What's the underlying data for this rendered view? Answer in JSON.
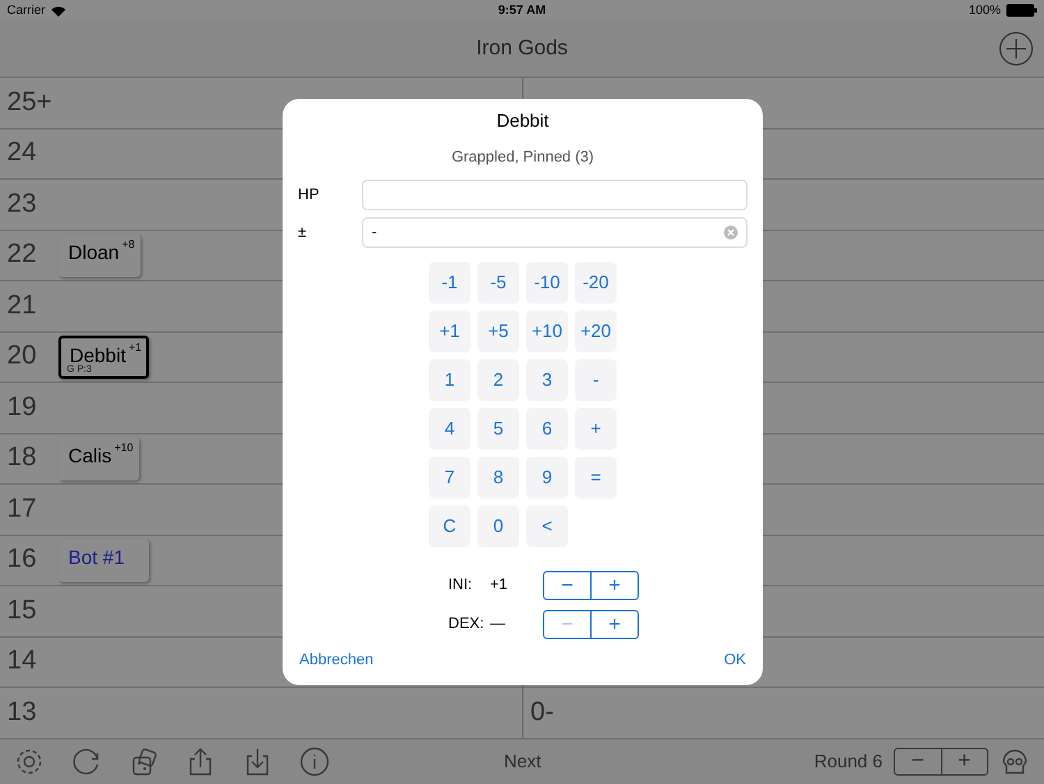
{
  "status_bar": {
    "carrier": "Carrier",
    "time": "9:57 AM",
    "battery": "100%"
  },
  "nav": {
    "title": "Iron Gods"
  },
  "left_rows": [
    {
      "label": "25+"
    },
    {
      "label": "24"
    },
    {
      "label": "23"
    },
    {
      "label": "22",
      "token": {
        "name": "Dloan",
        "modifier": "+8",
        "selected": false,
        "color": "#000000"
      }
    },
    {
      "label": "21"
    },
    {
      "label": "20",
      "token": {
        "name": "Debbit",
        "modifier": "+1",
        "note": "G P:3",
        "selected": true,
        "color": "#000000"
      }
    },
    {
      "label": "19"
    },
    {
      "label": "18",
      "token": {
        "name": "Calis",
        "modifier": "+10",
        "selected": false,
        "color": "#000000"
      }
    },
    {
      "label": "17"
    },
    {
      "label": "16",
      "token": {
        "name": "Bot #1",
        "selected": false,
        "color": "#1e1e8c"
      }
    },
    {
      "label": "15"
    },
    {
      "label": "14"
    },
    {
      "label": "13"
    }
  ],
  "right_rows": [
    {
      "label": "0-"
    }
  ],
  "dialog": {
    "title": "Debbit",
    "subtitle": "Grappled, Pinned (3)",
    "fields": [
      {
        "label": "HP",
        "clearable": false
      },
      {
        "label": "±",
        "value": "-",
        "clearable": true
      }
    ],
    "keypad": [
      [
        "-1",
        "-5",
        "-10",
        "-20"
      ],
      [
        "+1",
        "+5",
        "+10",
        "+20"
      ],
      [
        "1",
        "2",
        "3",
        "-"
      ],
      [
        "4",
        "5",
        "6",
        "+"
      ],
      [
        "7",
        "8",
        "9",
        "="
      ],
      [
        "C",
        "0",
        "<"
      ]
    ],
    "steppers": [
      {
        "label": "INI:",
        "value": "+1",
        "minus": "−",
        "plus": "+",
        "minus_disabled": false
      },
      {
        "label": "DEX:",
        "value": "—",
        "minus": "−",
        "plus": "+",
        "minus_disabled": true
      }
    ],
    "cancel": "Abbrechen",
    "ok": "OK"
  },
  "toolbar": {
    "next": "Next",
    "round": "Round 6",
    "minus": "−",
    "plus": "+"
  }
}
